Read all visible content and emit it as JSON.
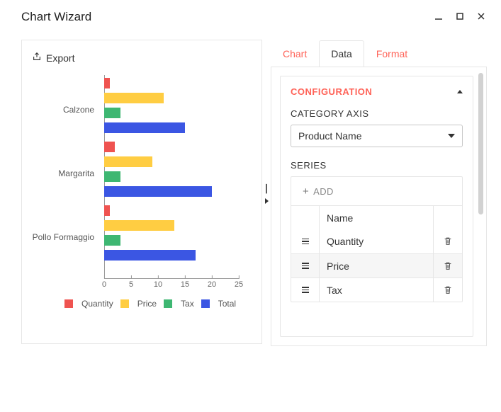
{
  "window": {
    "title": "Chart Wizard"
  },
  "export": {
    "label": "Export"
  },
  "tabs": {
    "chart": "Chart",
    "data": "Data",
    "format": "Format",
    "active": "Data"
  },
  "config": {
    "header": "CONFIGURATION",
    "category_axis_label": "CATEGORY AXIS",
    "category_axis_value": "Product Name",
    "series_label": "SERIES",
    "add_label": "ADD",
    "name_header": "Name",
    "series_rows": [
      {
        "name": "Quantity"
      },
      {
        "name": "Price"
      },
      {
        "name": "Tax"
      }
    ]
  },
  "chart_data": {
    "type": "bar",
    "orientation": "horizontal",
    "categories": [
      "Calzone",
      "Margarita",
      "Pollo Formaggio"
    ],
    "series": [
      {
        "name": "Quantity",
        "color": "#ef5350",
        "values": [
          1,
          2,
          1
        ]
      },
      {
        "name": "Price",
        "color": "#ffcd42",
        "values": [
          11,
          9,
          13
        ]
      },
      {
        "name": "Tax",
        "color": "#3eb772",
        "values": [
          3,
          3,
          3
        ]
      },
      {
        "name": "Total",
        "color": "#3b56e3",
        "values": [
          15,
          20,
          17
        ]
      }
    ],
    "xticks": [
      0,
      5,
      10,
      15,
      20,
      25
    ],
    "xlim": [
      0,
      25
    ],
    "title": "",
    "xlabel": "",
    "ylabel": ""
  },
  "legend": {
    "items": [
      {
        "label": "Quantity",
        "color": "#ef5350"
      },
      {
        "label": "Price",
        "color": "#ffcd42"
      },
      {
        "label": "Tax",
        "color": "#3eb772"
      },
      {
        "label": "Total",
        "color": "#3b56e3"
      }
    ]
  }
}
